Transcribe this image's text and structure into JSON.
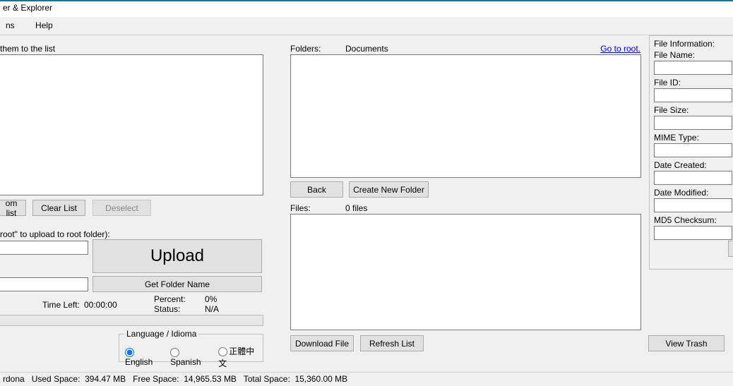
{
  "title": "er & Explorer",
  "menu": {
    "item1": "ns",
    "item2": "Help"
  },
  "left": {
    "hint": "them to the list",
    "btn_rom": "om list",
    "btn_clear": "Clear List",
    "btn_deselect": "Deselect",
    "upload_hint": "root\" to upload to root folder):",
    "btn_upload": "Upload",
    "btn_getfolder": "Get Folder Name",
    "time_left_label": "Time Left:",
    "time_left_val": "00:00:00",
    "percent_label": "Percent:",
    "percent_val": "0%",
    "status_label": "Status:",
    "status_val": "N/A",
    "lang_box": "Language / Idioma",
    "lang_en": "English",
    "lang_es": "Spanish",
    "lang_zh": "正體中文"
  },
  "mid": {
    "folders_label": "Folders:",
    "folders_path": "Documents",
    "goto_root": "Go to root.",
    "btn_back": "Back",
    "btn_newfolder": "Create New Folder",
    "files_label": "Files:",
    "files_count": "0 files",
    "btn_download": "Download File",
    "btn_refresh": "Refresh List"
  },
  "right": {
    "section": "File Information:",
    "name_label": "File Name:",
    "id_label": "File ID:",
    "size_label": "File Size:",
    "mime_label": "MIME Type:",
    "created_label": "Date Created:",
    "modified_label": "Date Modified:",
    "md5_label": "MD5 Checksum:",
    "btn_trash": "View Trash"
  },
  "status": {
    "author": "rdona",
    "used_l": "Used Space:",
    "used_v": "394.47 MB",
    "free_l": "Free Space:",
    "free_v": "14,965.53 MB",
    "total_l": "Total Space:",
    "total_v": "15,360.00 MB"
  }
}
